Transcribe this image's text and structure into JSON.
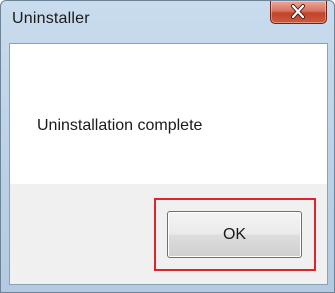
{
  "window": {
    "title": "Uninstaller",
    "close_icon": "close-icon"
  },
  "dialog": {
    "message": "Uninstallation complete",
    "ok_label": "OK"
  },
  "colors": {
    "highlight_border": "#e0222e",
    "close_button": "#c2432a",
    "frame": "#bed3e8"
  }
}
